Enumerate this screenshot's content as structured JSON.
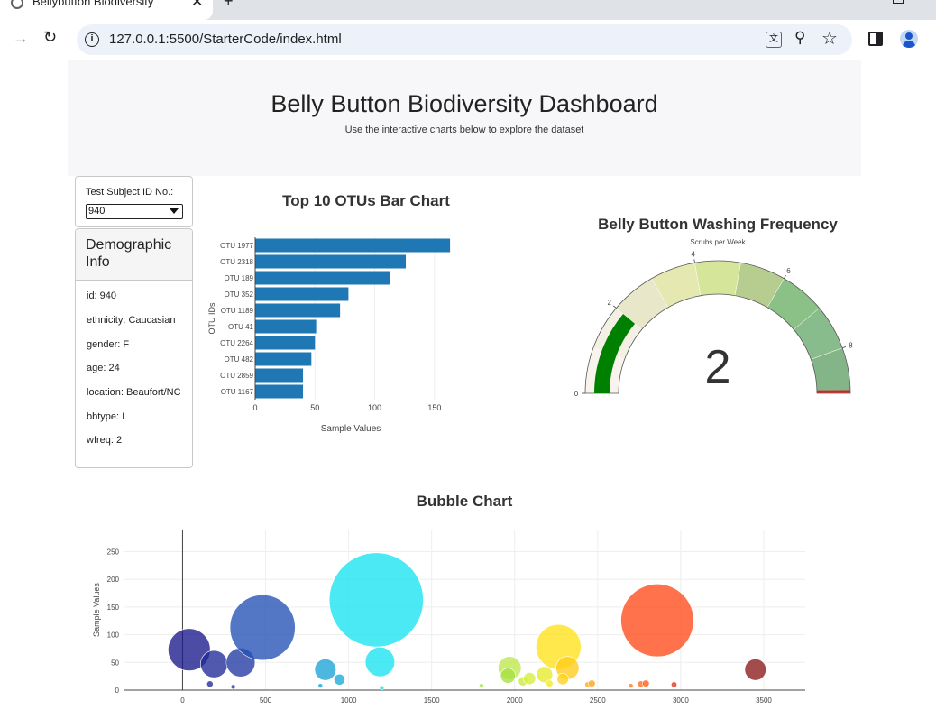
{
  "browser": {
    "tab_title": "Bellybutton Biodiversity",
    "new_tab_symbol": "+",
    "url": "127.0.0.1:5500/StarterCode/index.html"
  },
  "header": {
    "title": "Belly Button Biodiversity Dashboard",
    "subtitle": "Use the interactive charts below to explore the dataset"
  },
  "selector": {
    "label": "Test Subject ID No.:",
    "selected_value": "940"
  },
  "demographic": {
    "title": "Demographic Info",
    "items": [
      "id: 940",
      "ethnicity: Caucasian",
      "gender: F",
      "age: 24",
      "location: Beaufort/NC",
      "bbtype: I",
      "wfreq: 2"
    ]
  },
  "chart_data": [
    {
      "type": "bar",
      "orientation": "horizontal",
      "title": "Top 10 OTUs Bar Chart",
      "xlabel": "Sample Values",
      "ylabel": "OTU IDs",
      "xlim": [
        0,
        175
      ],
      "xticks": [
        0,
        50,
        100,
        150
      ],
      "categories": [
        "OTU 1977",
        "OTU 2318",
        "OTU 189",
        "OTU 352",
        "OTU 1189",
        "OTU 41",
        "OTU 2264",
        "OTU 482",
        "OTU 2859",
        "OTU 1167"
      ],
      "values": [
        163,
        126,
        113,
        78,
        71,
        51,
        50,
        47,
        40,
        40
      ],
      "color": "#1f77b4",
      "grid": true
    },
    {
      "type": "gauge",
      "title": "Belly Button Washing Frequency",
      "subtitle": "Scrubs per Week",
      "range": [
        0,
        9
      ],
      "ticks": [
        0,
        2,
        4,
        6,
        8
      ],
      "value": 2,
      "value_label": "2",
      "bar_color": "#008000",
      "threshold_color": "#e41a1c",
      "step_colors": [
        "#f8f3ec",
        "#f4f1e4",
        "#e9e7c9",
        "#e5e8b0",
        "#d5e599",
        "#b7cd8f",
        "#8bc086",
        "#89bc8d",
        "#84b589"
      ]
    },
    {
      "type": "scatter",
      "title": "Bubble Chart",
      "xlabel": "",
      "ylabel": "Sample Values",
      "xlim": [
        -350,
        3750
      ],
      "ylim": [
        0,
        290
      ],
      "xticks": [
        0,
        500,
        1000,
        1500,
        2000,
        2500,
        3000,
        3500
      ],
      "yticks": [
        0,
        50,
        100,
        150,
        200,
        250
      ],
      "grid": true,
      "points": [
        {
          "x": 40,
          "y": 73,
          "color": "#1a1a8c"
        },
        {
          "x": 190,
          "y": 47,
          "color": "#1f2a96"
        },
        {
          "x": 350,
          "y": 50,
          "color": "#2138a0"
        },
        {
          "x": 482,
          "y": 113,
          "color": "#2351b5"
        },
        {
          "x": 165,
          "y": 11,
          "color": "#1f2a96"
        },
        {
          "x": 305,
          "y": 6,
          "color": "#2138a0"
        },
        {
          "x": 860,
          "y": 37,
          "color": "#1aa3d6"
        },
        {
          "x": 945,
          "y": 19,
          "color": "#1aa9d9"
        },
        {
          "x": 830,
          "y": 8,
          "color": "#1aa3d6"
        },
        {
          "x": 1167,
          "y": 163,
          "color": "#18e3f0"
        },
        {
          "x": 1189,
          "y": 51,
          "color": "#18e3f0"
        },
        {
          "x": 1200,
          "y": 4,
          "color": "#18e3f0"
        },
        {
          "x": 1800,
          "y": 8,
          "color": "#a8e05a"
        },
        {
          "x": 1970,
          "y": 40,
          "color": "#bde84a"
        },
        {
          "x": 1960,
          "y": 26,
          "color": "#a6e040"
        },
        {
          "x": 2050,
          "y": 16,
          "color": "#c8ea3c"
        },
        {
          "x": 2090,
          "y": 21,
          "color": "#d6ed38"
        },
        {
          "x": 2180,
          "y": 28,
          "color": "#e6ea2a"
        },
        {
          "x": 2210,
          "y": 12,
          "color": "#efe92a"
        },
        {
          "x": 2264,
          "y": 78,
          "color": "#ffe11a"
        },
        {
          "x": 2318,
          "y": 40,
          "color": "#ffcc1a"
        },
        {
          "x": 2290,
          "y": 20,
          "color": "#ffd21a"
        },
        {
          "x": 2440,
          "y": 10,
          "color": "#ffa81a"
        },
        {
          "x": 2465,
          "y": 12,
          "color": "#ffa01a"
        },
        {
          "x": 2700,
          "y": 8,
          "color": "#ff7a1a"
        },
        {
          "x": 2760,
          "y": 11,
          "color": "#ff6a1a"
        },
        {
          "x": 2790,
          "y": 12,
          "color": "#ff5a1a"
        },
        {
          "x": 2859,
          "y": 126,
          "color": "#ff4a1a"
        },
        {
          "x": 2960,
          "y": 10,
          "color": "#e6301a"
        },
        {
          "x": 3450,
          "y": 37,
          "color": "#8b1a1a"
        }
      ],
      "sizes": [
        73,
        47,
        50,
        113,
        11,
        6,
        37,
        19,
        8,
        163,
        51,
        4,
        8,
        40,
        26,
        16,
        21,
        28,
        12,
        78,
        40,
        20,
        10,
        12,
        8,
        11,
        12,
        126,
        10,
        37
      ]
    }
  ]
}
